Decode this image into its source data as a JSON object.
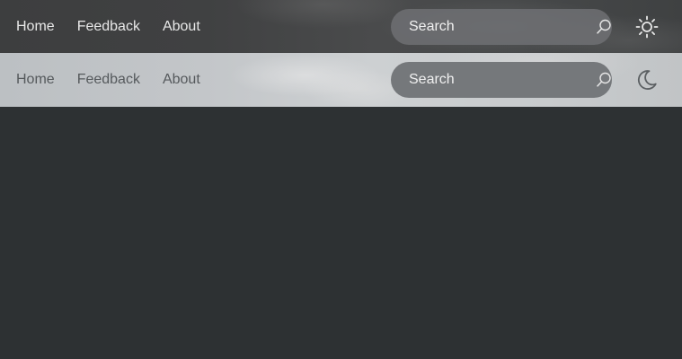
{
  "navbar_dark": {
    "links": [
      {
        "label": "Home"
      },
      {
        "label": "Feedback"
      },
      {
        "label": "About"
      }
    ],
    "search": {
      "placeholder": "Search",
      "icon": "search-icon"
    },
    "theme_toggle": {
      "icon": "sun-icon"
    }
  },
  "navbar_light": {
    "links": [
      {
        "label": "Home"
      },
      {
        "label": "Feedback"
      },
      {
        "label": "About"
      }
    ],
    "search": {
      "placeholder": "Search",
      "icon": "search-icon"
    },
    "theme_toggle": {
      "icon": "moon-icon"
    }
  },
  "colors": {
    "background": "#2d3133",
    "dark_nav_text": "#e8e8e8",
    "light_nav_text": "#55595c",
    "search_bg": "#75787b"
  }
}
